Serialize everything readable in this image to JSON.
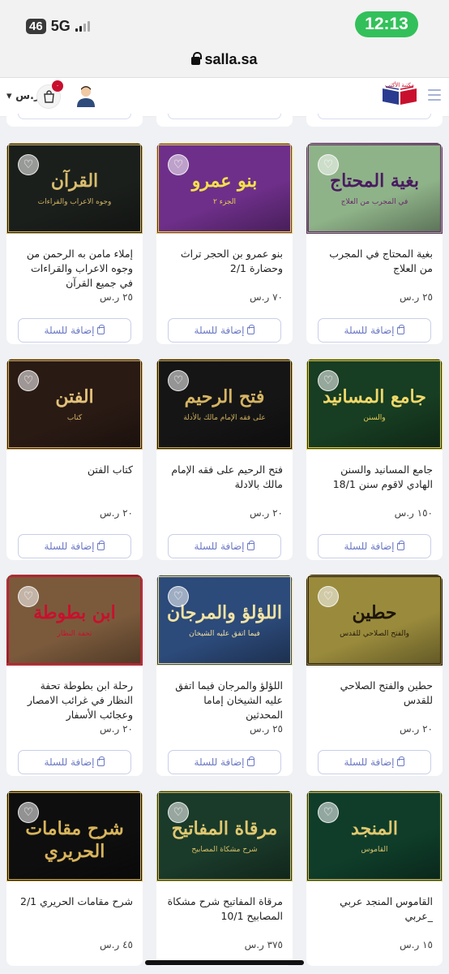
{
  "status_bar": {
    "network_badge": "46",
    "network_type": "5G",
    "time": "12:13"
  },
  "browser": {
    "url": "salla.sa"
  },
  "header": {
    "currency": "ر.س",
    "cart_count": "٠",
    "logo_text": "مكتبة الأكتب"
  },
  "add_to_cart_label": "إضافة للسلة",
  "products": [
    {
      "name": "بغية المحتاج في المجرب من العلاج",
      "price": "٢٥ ر.س",
      "cover_title": "بغية المحتاج",
      "cover_sub": "في المجرب من العلاج",
      "cover_bg": "#8fb389",
      "cover_fg": "#6a2a6b",
      "cover_title_color": "#4a1a60"
    },
    {
      "name": "بنو عمرو بن الحجر تراث وحضارة 2/1",
      "price": "٧٠ ر.س",
      "cover_title": "بنو عمرو",
      "cover_sub": "الجزء ٢",
      "cover_bg": "#6e2f8a",
      "cover_fg": "#e8d34a",
      "cover_title_color": "#f4e04d"
    },
    {
      "name": "إملاء مامن به الرحمن من وجوه الاعراب والقراءات في جميع القرآن",
      "price": "٢٥ ر.س",
      "cover_title": "القرآن",
      "cover_sub": "وجوه الاعراب والقراءات",
      "cover_bg": "#1b1f1c",
      "cover_fg": "#d3b465",
      "cover_title_color": "#d9bd6e"
    },
    {
      "name": "جامع المسانيد والسنن الهادي لاقوم سنن 18/1",
      "price": "١٥٠ ر.س",
      "cover_title": "جامع المسانيد",
      "cover_sub": "والسنن",
      "cover_bg": "#173d22",
      "cover_fg": "#e9cd53",
      "cover_title_color": "#f0d86a"
    },
    {
      "name": "فتح الرحيم على فقه الإمام مالك بالادلة",
      "price": "٢٠ ر.س",
      "cover_title": "فتح الرحيم",
      "cover_sub": "على فقه الإمام مالك بالأدلة",
      "cover_bg": "#151515",
      "cover_fg": "#cfae5c",
      "cover_title_color": "#d5b463"
    },
    {
      "name": "كتاب الفتن",
      "price": "٢٠ ر.س",
      "cover_title": "الفتن",
      "cover_sub": "كتاب",
      "cover_bg": "#2a1a14",
      "cover_fg": "#d8b56a",
      "cover_title_color": "#e2c27a"
    },
    {
      "name": "حطين والفتح الصلاحي للقدس",
      "price": "٢٠ ر.س",
      "cover_title": "حطين",
      "cover_sub": "والفتح الصلاحي للقدس",
      "cover_bg": "#9a8b3c",
      "cover_fg": "#2a1d0c",
      "cover_title_color": "#1e1508"
    },
    {
      "name": "اللؤلؤ والمرجان فيما اتفق عليه الشيخان إماما المحدثين",
      "price": "٢٥ ر.س",
      "cover_title": "اللؤلؤ والمرجان",
      "cover_sub": "فيما اتفق عليه الشيخان",
      "cover_bg": "#2c4a7a",
      "cover_fg": "#f0e0a0",
      "cover_title_color": "#f3e3a2"
    },
    {
      "name": "رحلة ابن بطوطة تحفة النظار في غرائب الامصار وعجائب الأسفار",
      "price": "٢٠ ر.س",
      "cover_title": "ابن بطوطة",
      "cover_sub": "تحفة النظار",
      "cover_bg": "#7b5a3c",
      "cover_fg": "#c8102e",
      "cover_title_color": "#c8102e"
    },
    {
      "name": "القاموس المنجد عربي _عربي",
      "price": "١٥ ر.س",
      "cover_title": "المنجد",
      "cover_sub": "القاموس",
      "cover_bg": "#0f3d2a",
      "cover_fg": "#d8c06a",
      "cover_title_color": "#e0c76f"
    },
    {
      "name": "مرقاة المفاتيح شرح مشكاة المصابيح 10/1",
      "price": "٣٧٥ ر.س",
      "cover_title": "مرقاة المفاتيح",
      "cover_sub": "شرح مشكاة المصابيح",
      "cover_bg": "#1a3a2a",
      "cover_fg": "#d8bf66",
      "cover_title_color": "#e0c870"
    },
    {
      "name": "شرح مقامات الحريري 2/1",
      "price": "٤٥ ر.س",
      "cover_title": "شرح مقامات الحريري",
      "cover_sub": "",
      "cover_bg": "#0e0e0e",
      "cover_fg": "#d8b45c",
      "cover_title_color": "#d8b45c"
    }
  ]
}
